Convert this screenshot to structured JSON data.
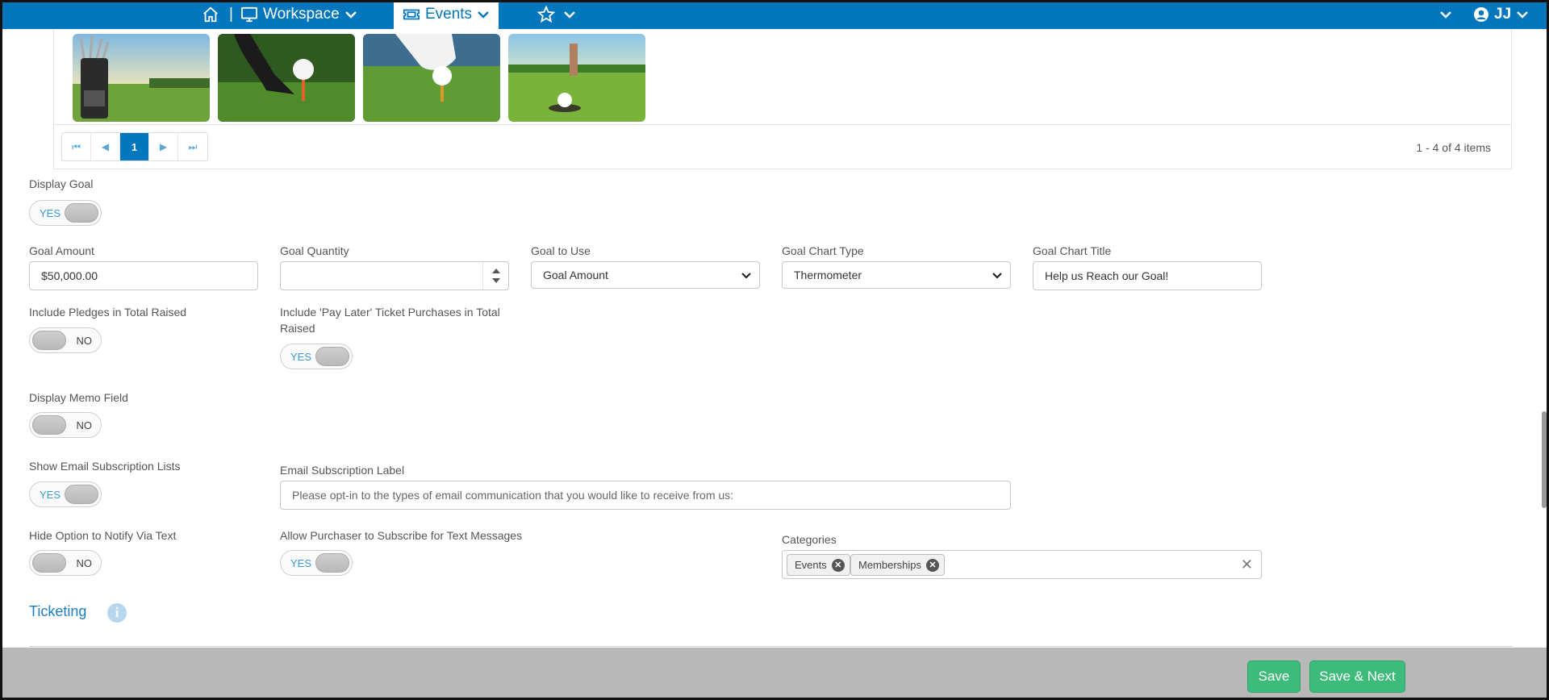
{
  "nav": {
    "separator": "|",
    "workspace_label": "Workspace",
    "events_label": "Events",
    "user_initials": "JJ"
  },
  "gallery": {
    "images": [
      "golf-bag-photo",
      "golf-club-ball-photo",
      "golf-ball-tee-photo",
      "golf-hole-photo"
    ]
  },
  "pager": {
    "current_page": "1",
    "info": "1 - 4 of 4 items"
  },
  "form": {
    "display_goal": {
      "label": "Display Goal",
      "value": "YES"
    },
    "goal_amount": {
      "label": "Goal Amount",
      "value": "$50,000.00"
    },
    "goal_quantity": {
      "label": "Goal Quantity",
      "value": ""
    },
    "goal_to_use": {
      "label": "Goal to Use",
      "value": "Goal Amount"
    },
    "goal_chart_type": {
      "label": "Goal Chart Type",
      "value": "Thermometer"
    },
    "goal_chart_title": {
      "label": "Goal Chart Title",
      "value": "Help us Reach our Goal!"
    },
    "include_pledges": {
      "label": "Include Pledges in Total Raised",
      "value": "NO"
    },
    "include_pay_later": {
      "label": "Include 'Pay Later' Ticket Purchases in Total Raised",
      "value": "YES"
    },
    "display_memo": {
      "label": "Display Memo Field",
      "value": "NO"
    },
    "show_email_lists": {
      "label": "Show Email Subscription Lists",
      "value": "YES"
    },
    "email_sub_label": {
      "label": "Email Subscription Label",
      "placeholder": "Please opt-in to the types of email communication that you would like to receive from us:"
    },
    "hide_notify_text": {
      "label": "Hide Option to Notify Via Text",
      "value": "NO"
    },
    "allow_text_sub": {
      "label": "Allow Purchaser to Subscribe for Text Messages",
      "value": "YES"
    },
    "categories": {
      "label": "Categories",
      "chips": [
        "Events",
        "Memberships"
      ]
    }
  },
  "ticketing": {
    "title": "Ticketing"
  },
  "footer": {
    "save_label": "Save",
    "save_next_label": "Save & Next"
  },
  "colors": {
    "nav_blue": "#0277bd",
    "accent_green": "#3dbb7a",
    "link_blue": "#1b7ec2"
  }
}
